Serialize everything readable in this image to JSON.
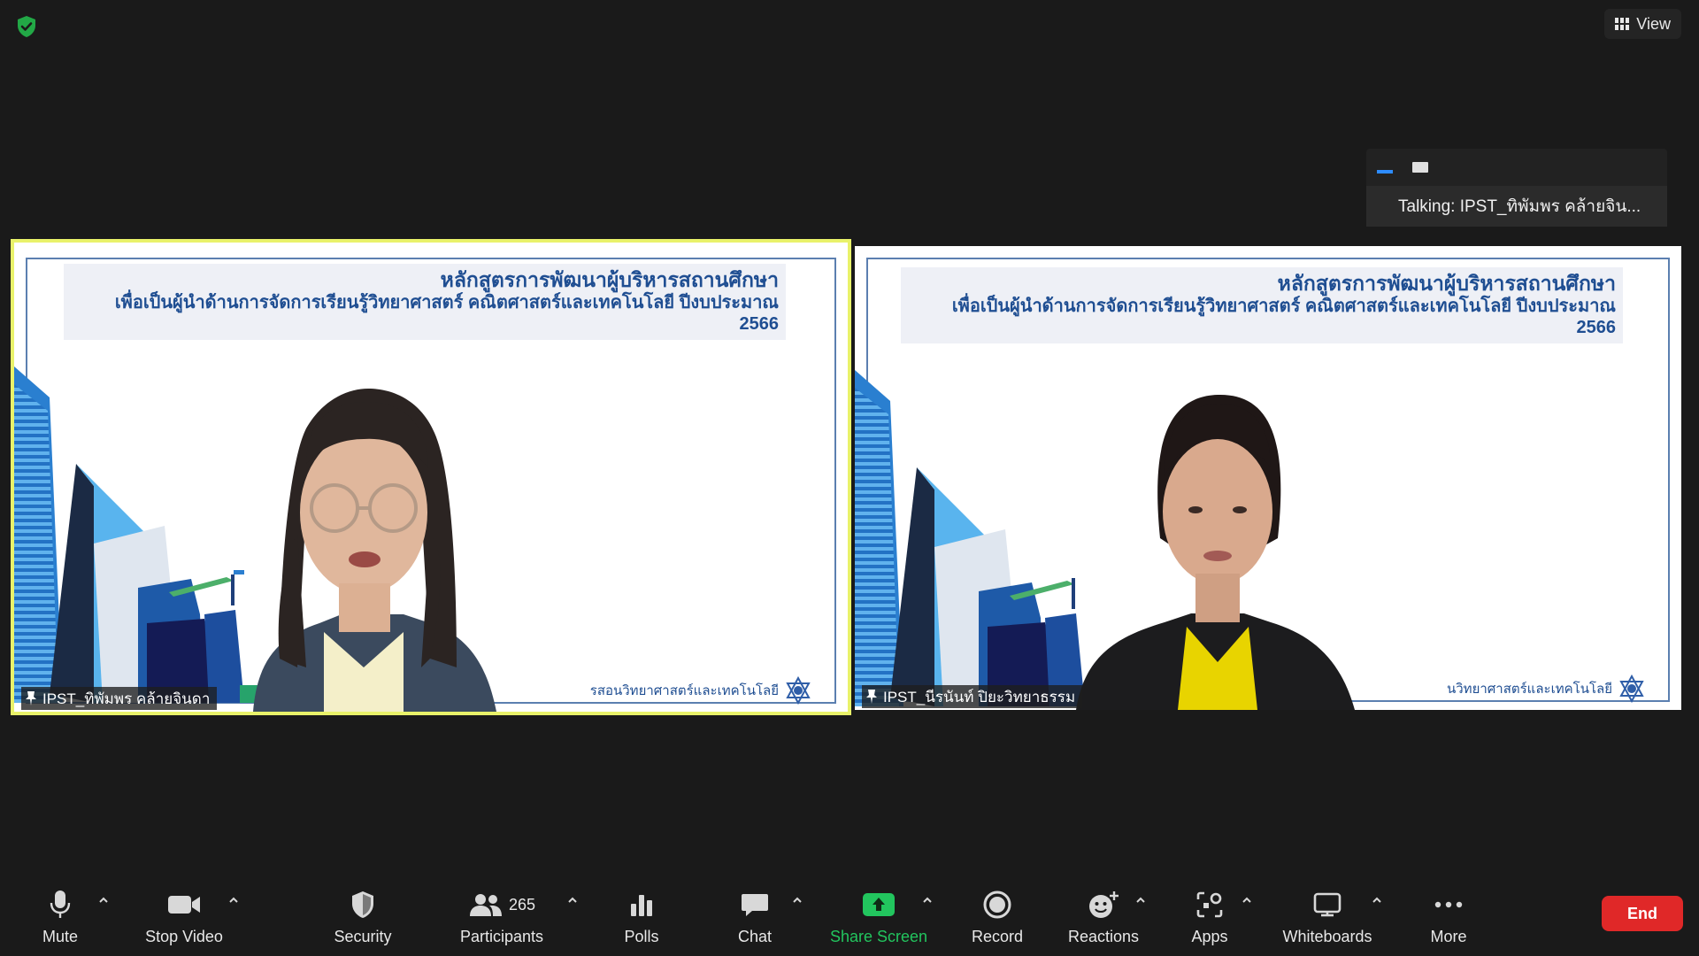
{
  "top": {
    "view_label": "View"
  },
  "talking_panel": {
    "text": "Talking:  IPST_ทิพัมพร คล้ายจิน..."
  },
  "tiles": [
    {
      "name": "IPST_ทิพัมพร คล้ายจินดา",
      "active": true,
      "slide_title_line1": "หลักสูตรการพัฒนาผู้บริหารสถานศึกษา",
      "slide_title_line2": "เพื่อเป็นผู้นำด้านการจัดการเรียนรู้วิทยาศาสตร์ คณิตศาสตร์และเทคโนโลยี ปีงบประมาณ 2566",
      "slide_footer": "รสอนวิทยาศาสตร์และเทคโนโลยี"
    },
    {
      "name": "IPST_นีรนันท์ ปิยะวิทยาธรรม",
      "active": false,
      "slide_title_line1": "หลักสูตรการพัฒนาผู้บริหารสถานศึกษา",
      "slide_title_line2": "เพื่อเป็นผู้นำด้านการจัดการเรียนรู้วิทยาศาสตร์ คณิตศาสตร์และเทคโนโลยี ปีงบประมาณ 2566",
      "slide_footer": "นวิทยาศาสตร์และเทคโนโลยี"
    }
  ],
  "toolbar": {
    "mute": "Mute",
    "stop_video": "Stop Video",
    "security": "Security",
    "participants": "Participants",
    "participants_count": "265",
    "polls": "Polls",
    "chat": "Chat",
    "share_screen": "Share Screen",
    "record": "Record",
    "reactions": "Reactions",
    "apps": "Apps",
    "whiteboards": "Whiteboards",
    "more": "More",
    "end": "End"
  },
  "colors": {
    "active_speaker_border": "#e9f26a",
    "share_green": "#22c55e",
    "end_red": "#e02828",
    "slide_blue": "#1f4e92"
  }
}
